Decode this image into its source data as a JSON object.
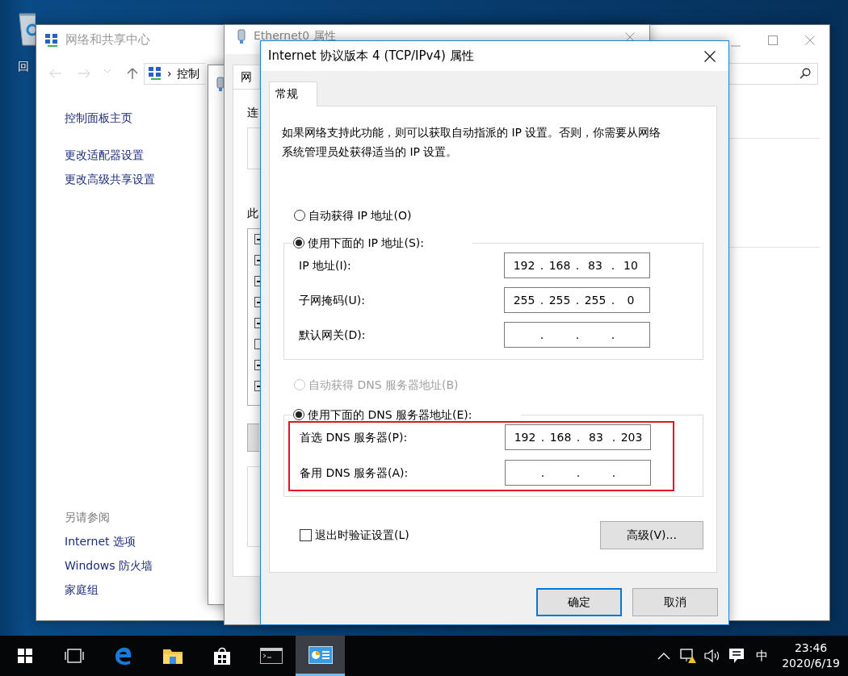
{
  "desktop": {
    "icons": [
      {
        "label": "回"
      }
    ]
  },
  "network_center": {
    "title": "网络和共享中心",
    "address": {
      "separator": "›",
      "text": "控制"
    },
    "sidebar": {
      "links": [
        {
          "label": "控制面板主页"
        },
        {
          "label": "更改适配器设置"
        },
        {
          "label": "更改高级共享设置"
        }
      ],
      "see_also_heading": "另请参阅",
      "see_also": [
        {
          "label": "Internet 选项"
        },
        {
          "label": "Windows 防火墙"
        },
        {
          "label": "家庭组"
        }
      ]
    }
  },
  "ethernet_properties": {
    "title": "Ethernet0 属性",
    "tab": "网",
    "labels": [
      "连",
      "此"
    ],
    "items": [
      {
        "checked": true
      },
      {
        "checked": true
      },
      {
        "checked": true
      },
      {
        "checked": true
      },
      {
        "checked": true
      },
      {
        "checked": false
      },
      {
        "checked": true
      },
      {
        "checked": true
      }
    ]
  },
  "ipv4_dialog": {
    "title": "Internet 协议版本 4 (TCP/IPv4) 属性",
    "tabs": [
      {
        "label": "常规",
        "selected": true
      }
    ],
    "description": "如果网络支持此功能，则可以获取自动指派的 IP 设置。否则，你需要从网络系统管理员处获得适当的 IP 设置。",
    "ip_mode": [
      {
        "label": "自动获得 IP 地址(O)",
        "selected": false,
        "disabled": false
      },
      {
        "label": "使用下面的 IP 地址(S):",
        "selected": true,
        "disabled": false
      }
    ],
    "ip_fields": [
      {
        "label": "IP 地址(I):",
        "octets": [
          "192",
          "168",
          "83",
          "10"
        ],
        "separators": [
          ".",
          ".",
          "."
        ]
      },
      {
        "label": "子网掩码(U):",
        "octets": [
          "255",
          "255",
          "255",
          "0"
        ],
        "separators": [
          ".",
          ".",
          "."
        ]
      },
      {
        "label": "默认网关(D):",
        "separators": [
          ".",
          ".",
          "."
        ]
      }
    ],
    "dns_mode": [
      {
        "label": "自动获得 DNS 服务器地址(B)",
        "selected": false,
        "disabled": true
      },
      {
        "label": "使用下面的 DNS 服务器地址(E):",
        "selected": true,
        "disabled": false
      }
    ],
    "dns_highlighted": true,
    "dns_fields": [
      {
        "label": "首选 DNS 服务器(P):",
        "octets": [
          "192",
          "168",
          "83",
          "203"
        ],
        "separators": [
          ".",
          ".",
          "."
        ]
      },
      {
        "label": "备用 DNS 服务器(A):",
        "separators": [
          ".",
          ".",
          "."
        ]
      }
    ],
    "validate_on_exit": {
      "label": "退出时验证设置(L)",
      "checked": false
    },
    "advanced_button": "高级(V)...",
    "buttons": [
      {
        "label": "确定",
        "default": true
      },
      {
        "label": "取消",
        "default": false
      }
    ]
  },
  "taskbar": {
    "apps": [
      {
        "kind": "start",
        "active": false
      },
      {
        "kind": "task_view",
        "active": false
      },
      {
        "kind": "edge",
        "active": false
      },
      {
        "kind": "explorer",
        "active": false
      },
      {
        "kind": "store",
        "active": false
      },
      {
        "kind": "cmd",
        "active": false
      },
      {
        "kind": "control_panel",
        "active": true
      }
    ],
    "tray": {
      "ime": "中",
      "time": "23:46",
      "date": "2020/6/19"
    }
  }
}
